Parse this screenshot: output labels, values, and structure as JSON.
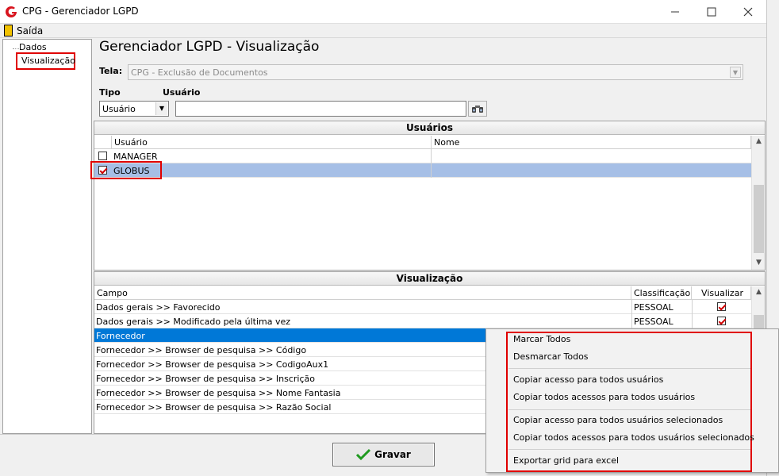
{
  "window": {
    "title": "CPG - Gerenciador LGPD"
  },
  "menu": {
    "exit_label": "Saída"
  },
  "tree": {
    "items": [
      {
        "label": "Dados"
      },
      {
        "label": "Visualização"
      }
    ]
  },
  "page": {
    "title": "Gerenciador LGPD - Visualização"
  },
  "filters": {
    "tela_label": "Tela:",
    "tela_value": "CPG - Exclusão de Documentos",
    "tipo_label": "Tipo",
    "tipo_value": "Usuário",
    "usuario_label": "Usuário",
    "usuario_value": ""
  },
  "users_panel": {
    "title": "Usuários",
    "columns": [
      "Usuário",
      "Nome"
    ],
    "rows": [
      {
        "usuario": "MANAGER",
        "nome": "",
        "checked": false
      },
      {
        "usuario": "GLOBUS",
        "nome": "",
        "checked": true
      }
    ]
  },
  "vis_panel": {
    "title": "Visualização",
    "columns": [
      "Campo",
      "Classificação",
      "Visualizar"
    ],
    "rows": [
      {
        "campo": "Dados gerais >> Favorecido",
        "classificacao": "PESSOAL",
        "visualizar": true
      },
      {
        "campo": "Dados gerais >> Modificado pela última vez",
        "classificacao": "PESSOAL",
        "visualizar": true
      },
      {
        "campo": "Fornecedor",
        "classificacao": "",
        "visualizar": false
      },
      {
        "campo": "Fornecedor >> Browser de pesquisa >> Código",
        "classificacao": "",
        "visualizar": false
      },
      {
        "campo": "Fornecedor >> Browser de pesquisa >> CodigoAux1",
        "classificacao": "",
        "visualizar": false
      },
      {
        "campo": "Fornecedor >> Browser de pesquisa >> Inscrição",
        "classificacao": "",
        "visualizar": false
      },
      {
        "campo": "Fornecedor >> Browser de pesquisa >> Nome Fantasia",
        "classificacao": "",
        "visualizar": false
      },
      {
        "campo": "Fornecedor >> Browser de pesquisa >> Razão Social",
        "classificacao": "",
        "visualizar": false
      }
    ]
  },
  "buttons": {
    "save_label": "Gravar"
  },
  "context_menu": {
    "items": [
      "Marcar Todos",
      "Desmarcar Todos",
      "Copiar acesso para todos usuários",
      "Copiar todos acessos para todos usuários",
      "Copiar acesso para todos usuários selecionados",
      "Copiar todos acessos para todos usuários selecionados",
      "Exportar grid para excel"
    ]
  },
  "colors": {
    "selection": "#a6bfe6",
    "row_active": "#0078d7",
    "highlight_box": "#e00000",
    "check": "#d00000"
  }
}
